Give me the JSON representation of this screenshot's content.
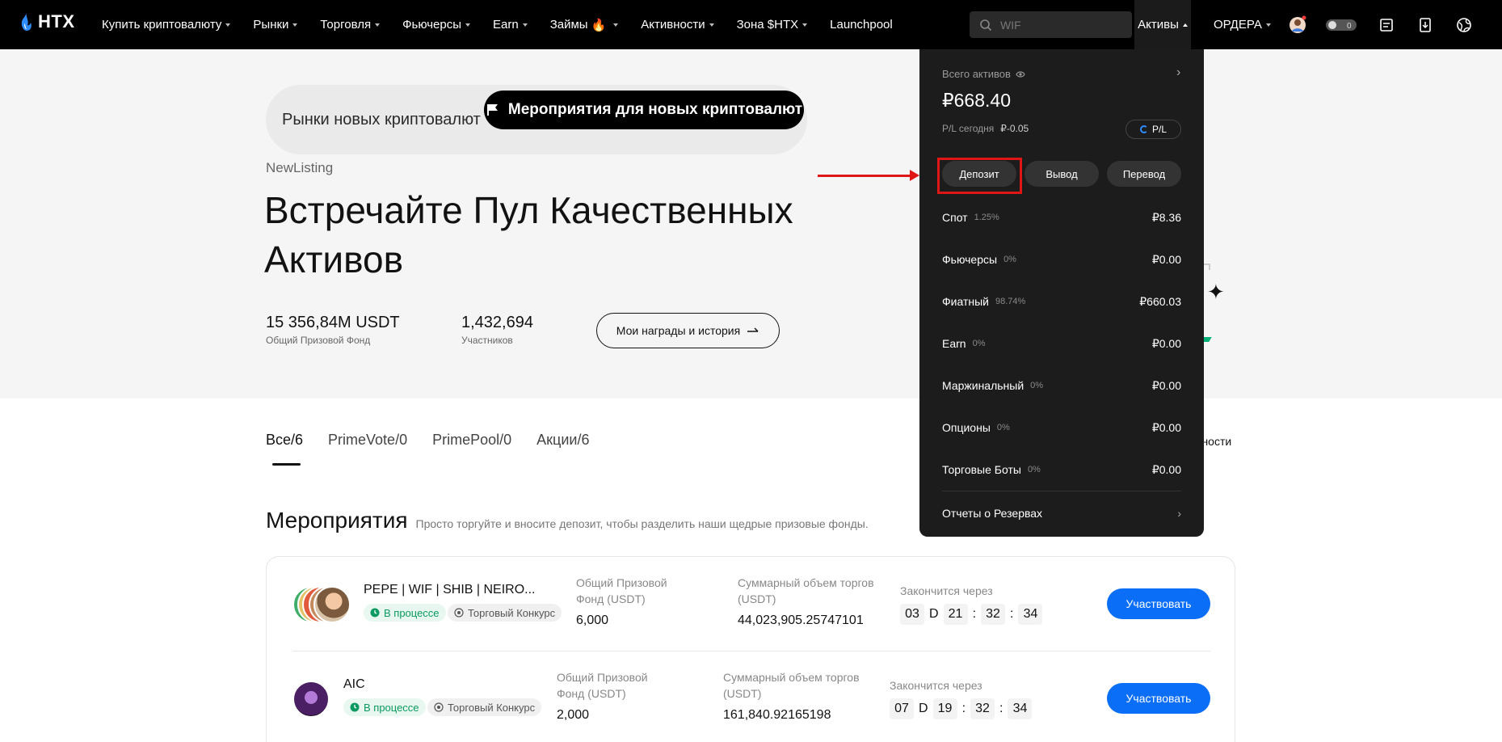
{
  "brand": {
    "name": "HTX"
  },
  "nav": {
    "items": [
      {
        "label": "Купить криптовалюту",
        "caret": true
      },
      {
        "label": "Рынки",
        "caret": true
      },
      {
        "label": "Торговля",
        "caret": true
      },
      {
        "label": "Фьючерсы",
        "caret": true
      },
      {
        "label": "Earn",
        "caret": true
      },
      {
        "label": "Займы",
        "caret": true,
        "fire": true
      },
      {
        "label": "Активности",
        "caret": true
      },
      {
        "label": "Зона $HTX",
        "caret": true
      },
      {
        "label": "Launchpool",
        "caret": false
      }
    ],
    "search_placeholder": "WIF",
    "assets_label": "Активы",
    "orders_label": "ОРДЕРА",
    "toggle_badge": "0",
    "icons": [
      "avatar-icon",
      "toggle-icon",
      "orders-list-icon",
      "download-icon",
      "globe-icon"
    ]
  },
  "hero": {
    "seg_left": "Рынки новых криптовалют",
    "seg_active": "Мероприятия для новых криптовалют",
    "label": "NewListing",
    "title": "Встречайте Пул Качественных Активов",
    "stat1_value": "15 356,84M USDT",
    "stat1_label": "Общий Призовой Фонд",
    "stat2_value": "1,432,694",
    "stat2_label": "Участников",
    "rewards_button": "Мои награды и история"
  },
  "tabs": {
    "items": [
      "Все/6",
      "PrimeVote/0",
      "PrimePool/0",
      "Акции/6"
    ],
    "active_index": 0,
    "right_partial": "вности"
  },
  "events": {
    "title": "Мероприятия",
    "subtitle": "Просто торгуйте и вносите депозит, чтобы разделить наши щедрые призовые фонды.",
    "rows": [
      {
        "name": "PEPE | WIF | SHIB | NEIRO...",
        "status": "В процессе",
        "type": "Торговый Конкурс",
        "pool_label": "Общий Призовой Фонд (USDT)",
        "pool_value": "6,000",
        "volume_label": "Суммарный объем торгов (USDT)",
        "volume_value": "44,023,905.25747101",
        "ends_label": "Закончится через",
        "days": "03",
        "d": "D",
        "hours": "21",
        "minutes": "32",
        "seconds": "34",
        "button": "Участвовать"
      },
      {
        "name": "AIC",
        "status": "В процессе",
        "type": "Торговый Конкурс",
        "pool_label": "Общий Призовой Фонд (USDT)",
        "pool_value": "2,000",
        "volume_label": "Суммарный объем торгов (USDT)",
        "volume_value": "161,840.92165198",
        "ends_label": "Закончится через",
        "days": "07",
        "d": "D",
        "hours": "19",
        "minutes": "32",
        "seconds": "34",
        "button": "Участвовать"
      }
    ]
  },
  "assets_dropdown": {
    "total_label": "Всего активов",
    "total_value": "₽668.40",
    "pl_label": "P/L сегодня",
    "pl_value": "₽-0.05",
    "pl_button": "P/L",
    "deposit": "Депозит",
    "withdraw": "Вывод",
    "transfer": "Перевод",
    "rows": [
      {
        "name": "Спот",
        "pct": "1.25%",
        "amount": "₽8.36"
      },
      {
        "name": "Фьючерсы",
        "pct": "0%",
        "amount": "₽0.00"
      },
      {
        "name": "Фиатный",
        "pct": "98.74%",
        "amount": "₽660.03"
      },
      {
        "name": "Earn",
        "pct": "0%",
        "amount": "₽0.00"
      },
      {
        "name": "Маржинальный",
        "pct": "0%",
        "amount": "₽0.00"
      },
      {
        "name": "Опционы",
        "pct": "0%",
        "amount": "₽0.00"
      },
      {
        "name": "Торговые Боты",
        "pct": "0%",
        "amount": "₽0.00"
      }
    ],
    "reserves": "Отчеты о Резервах"
  },
  "colors": {
    "accent_blue": "#0b6ef7",
    "annotation_red": "#e01616",
    "status_green": "#0a9a61"
  }
}
